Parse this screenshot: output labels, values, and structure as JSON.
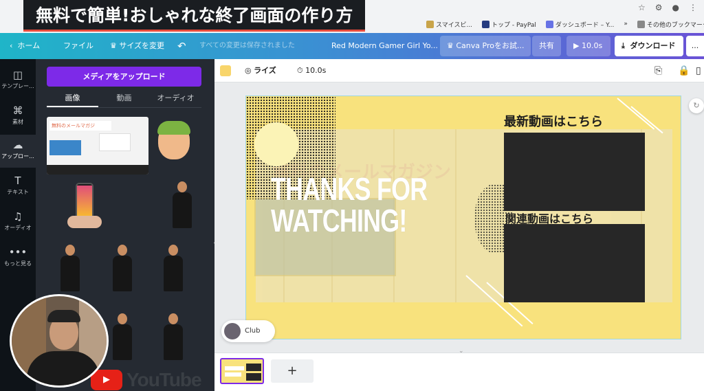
{
  "overlay_title": "無料で簡単!おしゃれな終了画面の作り方",
  "browser": {
    "bookmarks": [
      "スマイスビ...",
      "トップ - PayPal",
      "ダッシュボード – Y...",
      "»",
      "その他のブックマーク"
    ]
  },
  "header": {
    "home": "ホーム",
    "file": "ファイル",
    "resize": "サイズを変更",
    "undo_icon": "undo-icon",
    "saved_status": "すべての変更は保存されました",
    "design_title": "Red Modern Gamer Girl Yo...",
    "canva_pro": "Canva Proをお試...",
    "share": "共有",
    "play_time": "10.0s",
    "download": "ダウンロード",
    "more": "..."
  },
  "rail": [
    {
      "icon": "template-icon",
      "glyph": "◫",
      "label": "テンプレー..."
    },
    {
      "icon": "elements-icon",
      "glyph": "⌘",
      "label": "素材"
    },
    {
      "icon": "upload-icon",
      "glyph": "☁",
      "label": "アップロー..."
    },
    {
      "icon": "text-icon",
      "glyph": "T",
      "label": "テキスト"
    },
    {
      "icon": "audio-icon",
      "glyph": "♫",
      "label": "オーディオ"
    },
    {
      "icon": "more-icon",
      "glyph": "•••",
      "label": "もっと見る"
    }
  ],
  "panel": {
    "upload_button": "メディアをアップロード",
    "tabs": [
      "画像",
      "動画",
      "オーディオ"
    ],
    "thumb_text": "無料のメールマガジ"
  },
  "toolbar": {
    "swatch_color": "#f8d56b",
    "animate": "ライズ",
    "duration": "10.0s"
  },
  "design": {
    "thanks_line1": "THANKS FOR",
    "thanks_line2": "WATCHING!",
    "heading_latest": "最新動画はこちら",
    "heading_related": "関連動画はこちら",
    "ghost_text": "無料のメールマガジン",
    "bg_color": "#f8e27d"
  },
  "club_label": "Club",
  "add_page": "+",
  "youtube_word": "YouTube"
}
